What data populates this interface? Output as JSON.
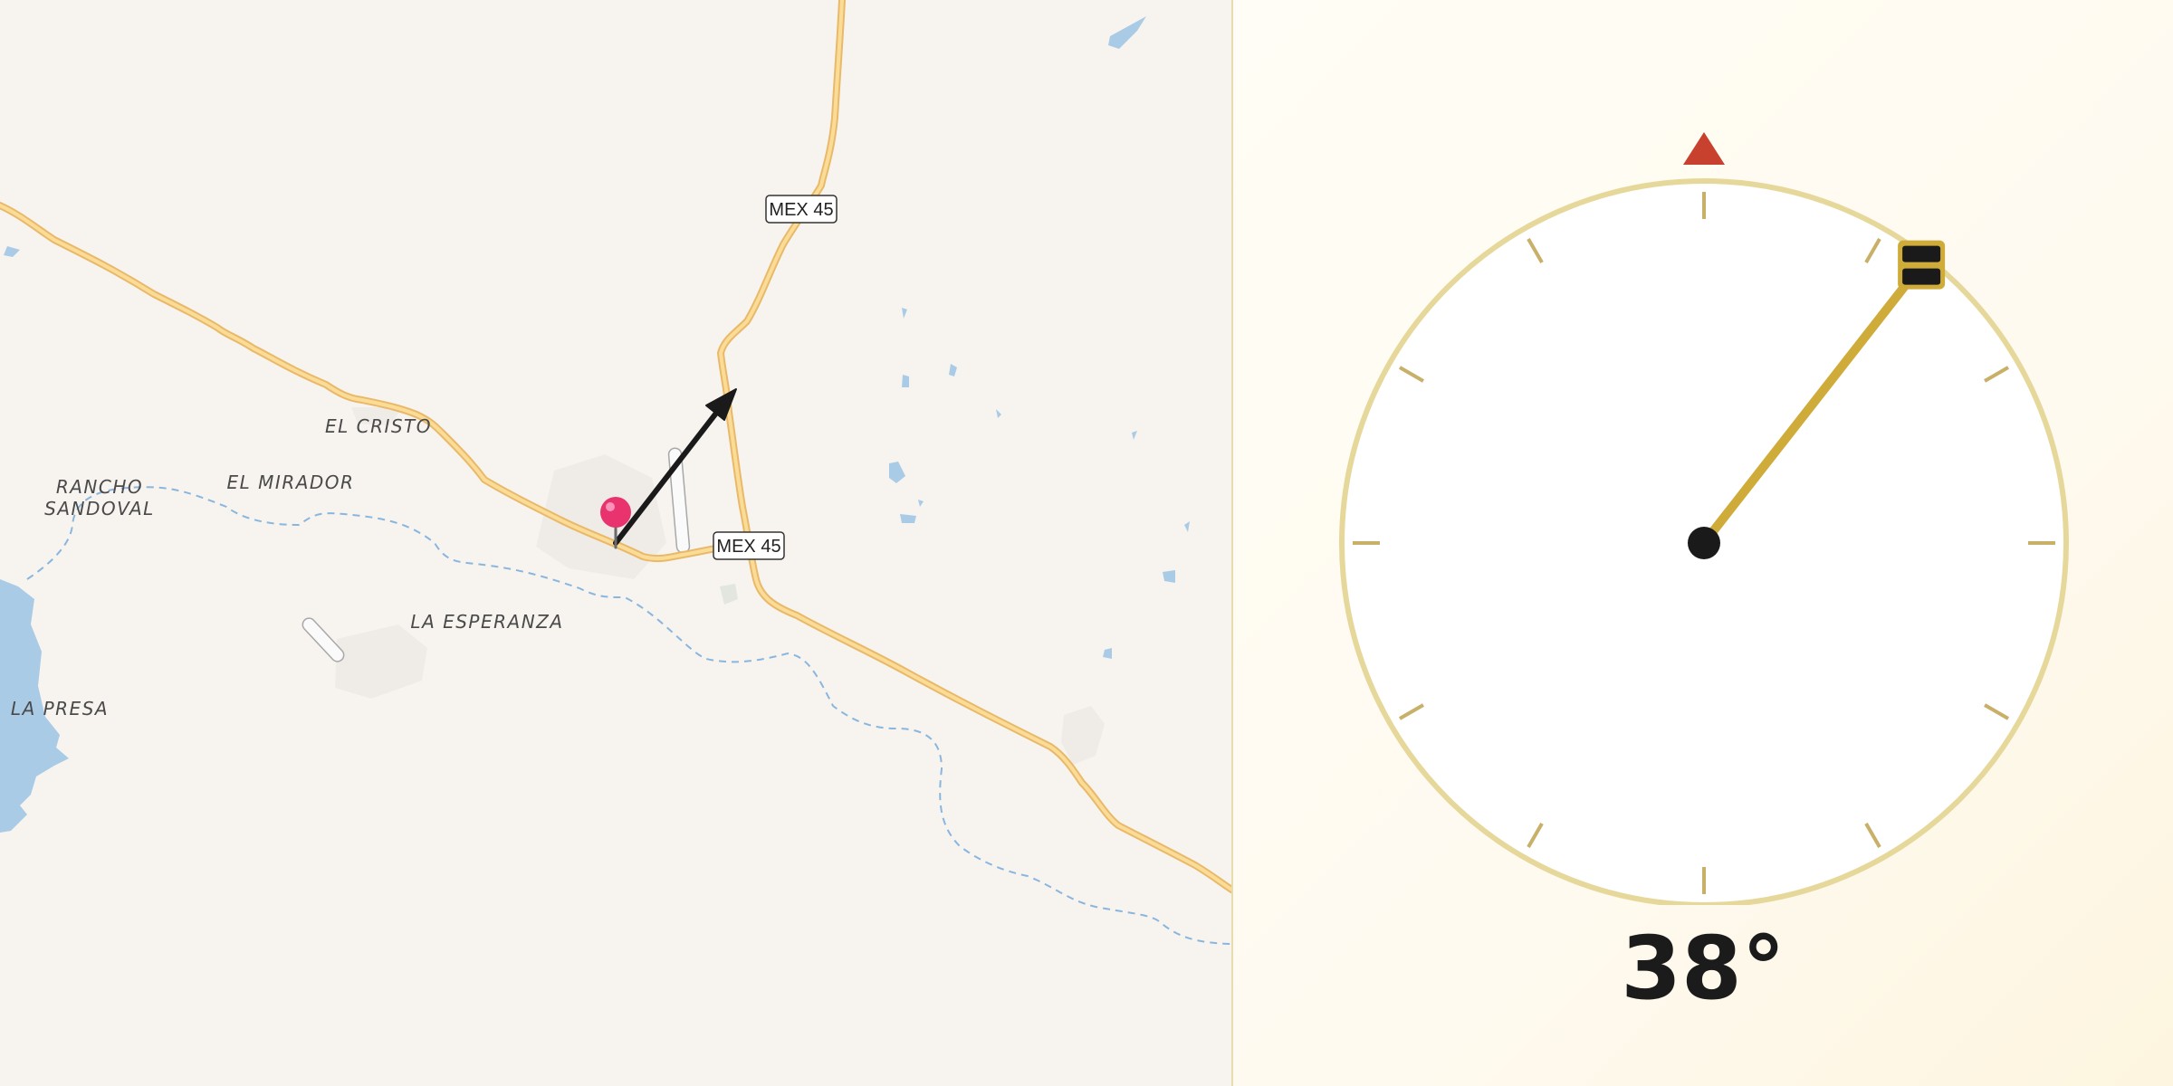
{
  "map": {
    "place_labels": {
      "el_cristo": "EL CRISTO",
      "rancho_line1": "RANCHO",
      "rancho_line2": "SANDOVAL",
      "el_mirador": "EL MIRADOR",
      "la_esperanza": "LA ESPERANZA",
      "la_presa": "LA PRESA"
    },
    "road_shields": {
      "upper": "MEX 45",
      "lower": "MEX 45"
    },
    "colors": {
      "background": "#f7f4f0",
      "road_fill": "#fbdc97",
      "road_casing": "#e9b96a",
      "water": "#a9cbe6",
      "river": "#8ab6de",
      "pin": "#e8336f",
      "arrow": "#1a1a1a"
    },
    "icons": [
      "map-pin-icon",
      "direction-arrow-icon"
    ]
  },
  "compass": {
    "heading_degrees": 38,
    "heading_text": "38°",
    "colors": {
      "ring": "#e6d89a",
      "ticks": "#c8b069",
      "needle": "#cfac3a",
      "north_marker": "#c8402e",
      "hub": "#1a1a1a",
      "handle": "#1a1a1a"
    },
    "icons": [
      "north-marker-icon",
      "needle-handle-icon"
    ]
  }
}
